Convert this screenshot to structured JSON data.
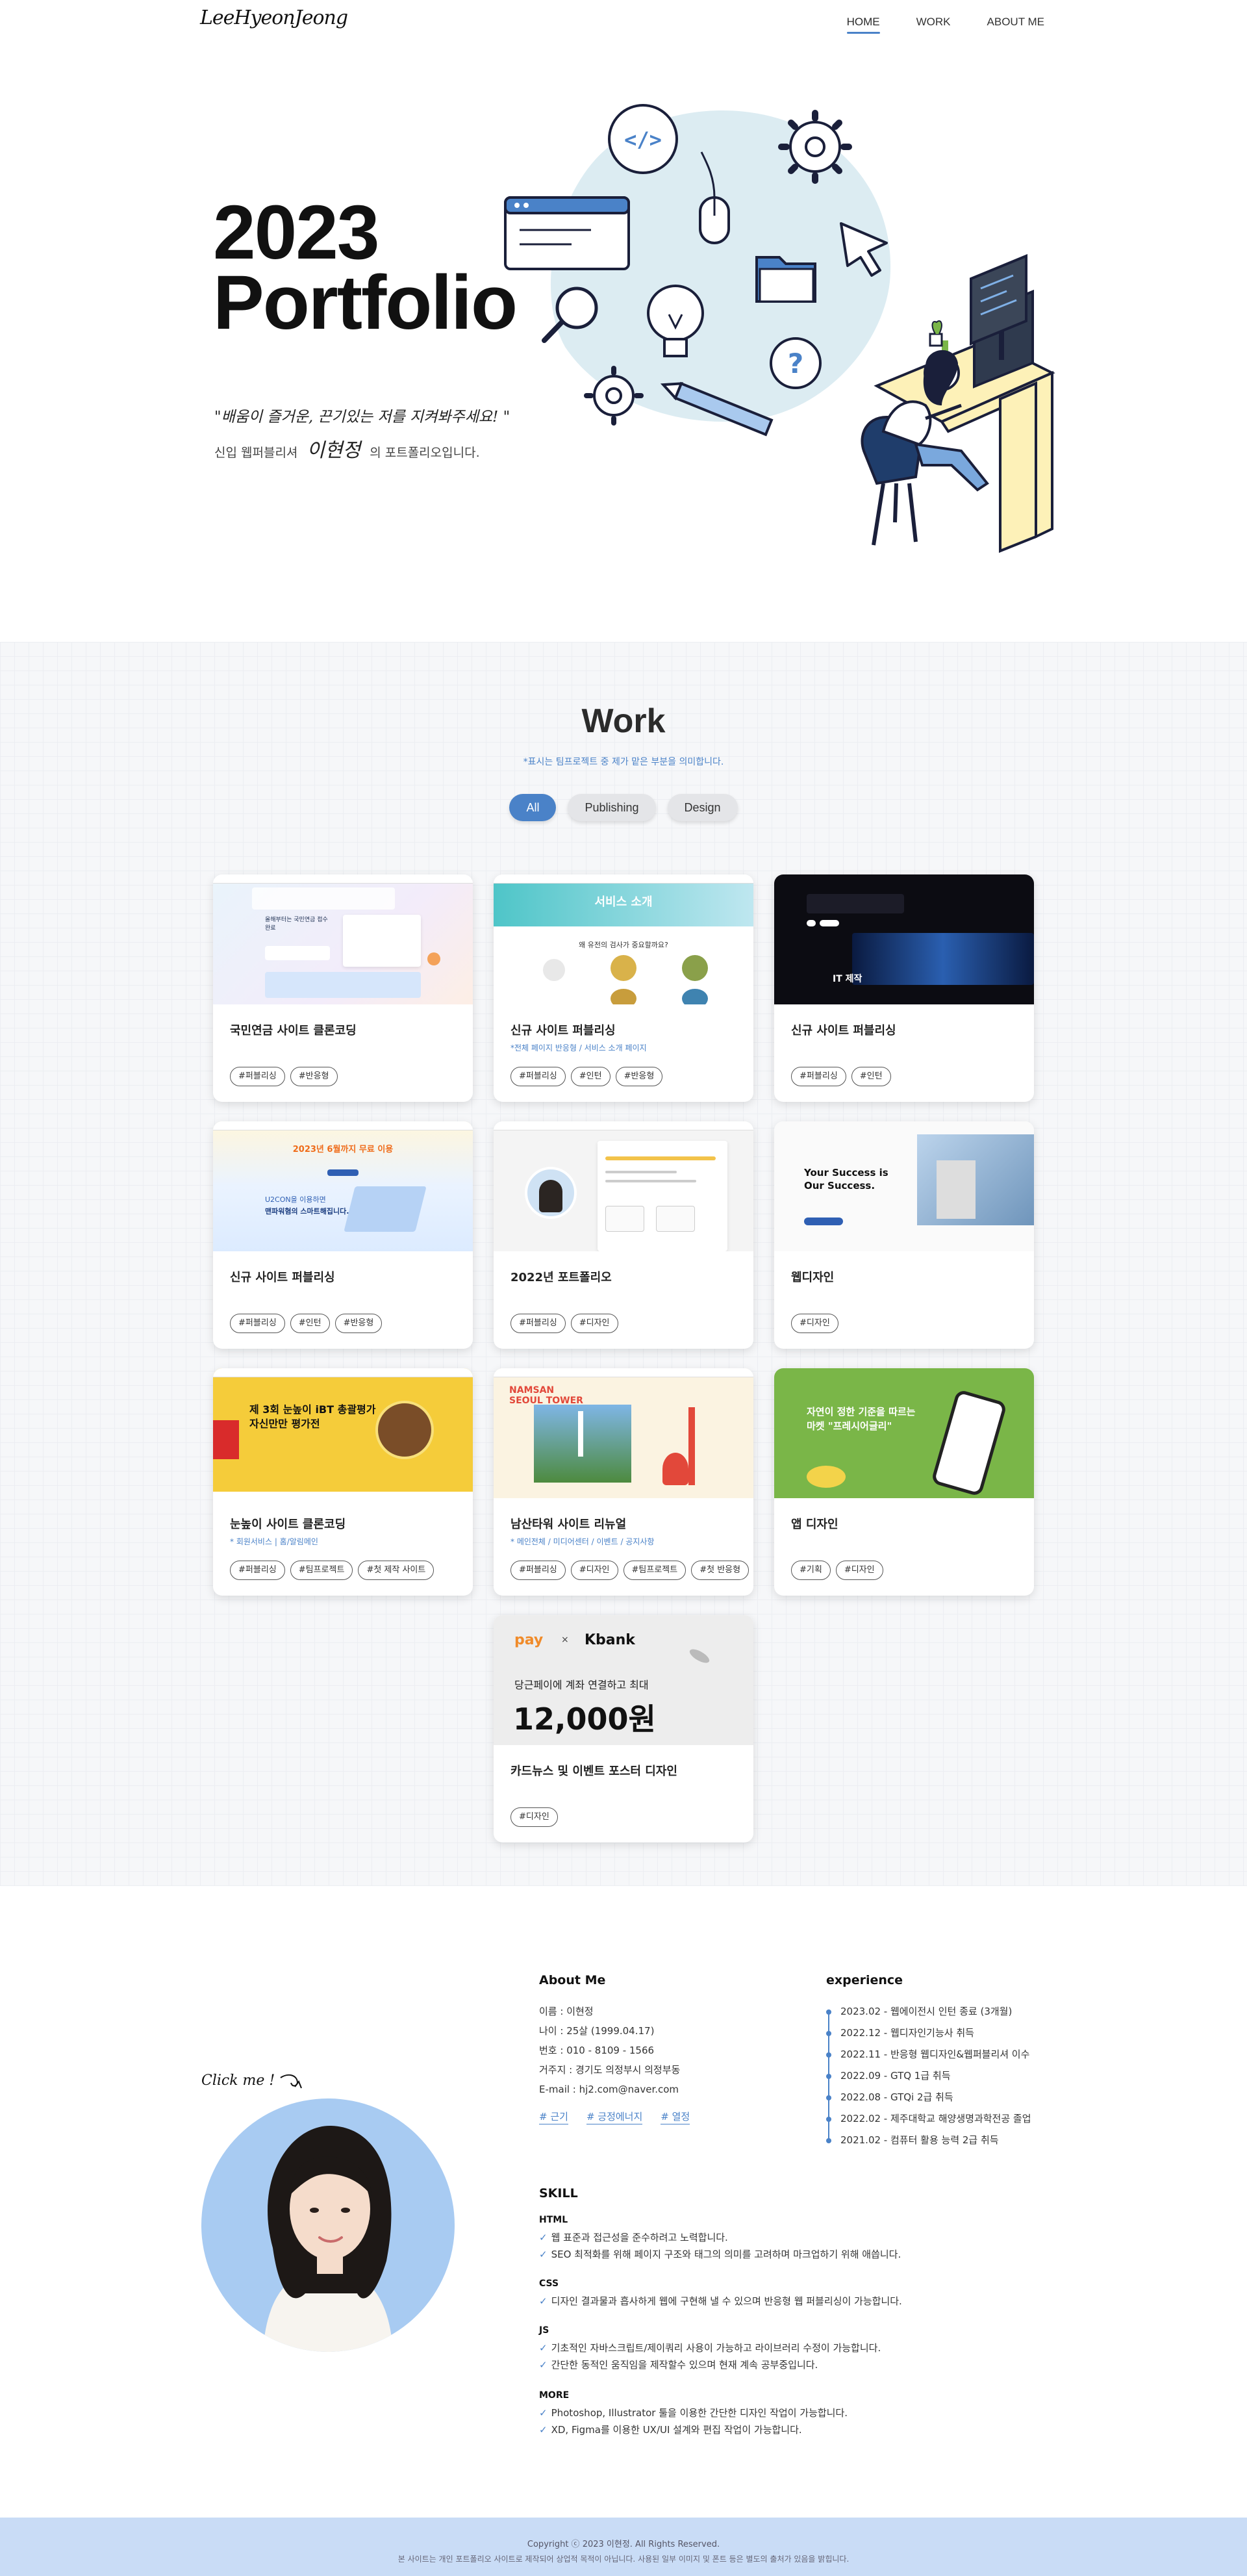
{
  "header": {
    "logo": "LeeHyeonJeong",
    "nav": [
      "HOME",
      "WORK",
      "ABOUT ME"
    ]
  },
  "hero": {
    "title_line1": "2023",
    "title_line2": "Portfolio",
    "quote": "\"배움이 즐거운, 끈기있는 저를 지켜봐주세요! \"",
    "intro_prefix": "신입 웹퍼블리셔",
    "intro_name": "이현정",
    "intro_suffix": "의 포트폴리오입니다."
  },
  "work": {
    "title": "Work",
    "subtitle": "*표시는 팀프로젝트 중 제가 맡은 부분을 의미합니다.",
    "filters": [
      "All",
      "Publishing",
      "Design"
    ],
    "cards": [
      {
        "title": "국민연금 사이트 클론코딩",
        "desc": "",
        "tags": [
          "#퍼블리싱",
          "#반응형"
        ]
      },
      {
        "title": "신규 사이트 퍼블리싱",
        "desc": "*전체 페이지 반응형 / 서비스 소개 페이지",
        "tags": [
          "#퍼블리싱",
          "#인턴",
          "#반응형"
        ]
      },
      {
        "title": "신규 사이트 퍼블리싱",
        "desc": "",
        "tags": [
          "#퍼블리싱",
          "#인턴"
        ]
      },
      {
        "title": "신규 사이트 퍼블리싱",
        "desc": "",
        "tags": [
          "#퍼블리싱",
          "#인턴",
          "#반응형"
        ]
      },
      {
        "title": "2022년 포트폴리오",
        "desc": "",
        "tags": [
          "#퍼블리싱",
          "#디자인"
        ]
      },
      {
        "title": "웹디자인",
        "desc": "",
        "tags": [
          "#디자인"
        ]
      },
      {
        "title": "눈높이 사이트 클론코딩",
        "desc": "* 회원서비스 | 홈/알림메인",
        "tags": [
          "#퍼블리싱",
          "#팀프로젝트",
          "#첫 제작 사이트"
        ]
      },
      {
        "title": "남산타워 사이트 리뉴얼",
        "desc": "* 메인전체 / 미디어센터 / 이벤트 / 공지사항",
        "tags": [
          "#퍼블리싱",
          "#디자인",
          "#팀프로젝트",
          "#첫 반응형"
        ]
      },
      {
        "title": "앱 디자인",
        "desc": "",
        "tags": [
          "#기획",
          "#디자인"
        ]
      },
      {
        "title": "카드뉴스 및 이벤트 포스터 디자인",
        "desc": "",
        "tags": [
          "#디자인"
        ]
      }
    ],
    "thumb_text": {
      "service": "서비스 소개",
      "service_q": "왜 유전의 검사가 중요할까요?",
      "nps_text": "올해부터는 국민연금 접수 완료",
      "dark_text": "IT 제작",
      "blue_head": "2023년 6월까지 무료 이용",
      "blue_brand": "U2CON을 이용하면",
      "blue_sub": "맨파워혐의 스마트해집니다.",
      "web_line1": "Your Success is",
      "web_line2": "Our Success.",
      "yellow_line1": "제 3회 눈높이 iBT 총괄평가",
      "yellow_line2": "자신만만 평가전",
      "namsan_title": "NAMSAN SEOUL TOWER",
      "app_line1": "자연이 정한 기준을 따르는",
      "app_line2": "마켓 \"프레시어글리\"",
      "kbank_brand1": "pay",
      "kbank_brand2": "Kbank",
      "kbank_line": "당근페이에 계좌 연결하고 최대",
      "kbank_amount": "12,000원"
    }
  },
  "about": {
    "click_me": "Click me !",
    "about_title": "About Me",
    "info": [
      "이름 : 이현정",
      "나이 : 25살 (1999.04.17)",
      "번호 : 010 - 8109 - 1566",
      "거주지 : 경기도 의정부시 의정부동",
      "E-mail : hj2.com@naver.com"
    ],
    "links": [
      "# 근기",
      "# 긍정에너지",
      "# 열정"
    ],
    "experience_title": "experience",
    "experience": [
      "2023.02 - 웹에이전시 인턴 종료 (3개월)",
      "2022.12 - 웹디자인기능사 취득",
      "2022.11 - 반응형 웹디자인&웹퍼블리셔 이수",
      "2022.09 - GTQ 1급 취득",
      "2022.08 - GTQi 2급 취득",
      "2022.02 - 제주대학교 해양생명과학전공 졸업",
      "2021.02 - 컴퓨터 활용 능력 2급 취득"
    ],
    "skill_title": "SKILL",
    "skills": [
      {
        "cat": "HTML",
        "items": [
          "웹 표준과 접근성을 준수하려고 노력합니다.",
          "SEO 최적화를 위해 페이지 구조와 태그의 의미를 고려하며 마크업하기 위해 애씁니다."
        ]
      },
      {
        "cat": "CSS",
        "items": [
          "디자인 결과물과 흡사하게 웹에 구현해 낼 수 있으며 반응형 웹 퍼블리싱이 가능합니다."
        ]
      },
      {
        "cat": "JS",
        "items": [
          "기초적인 자바스크립트/제이쿼리 사용이 가능하고 라이브러리 수정이 가능합니다.",
          "간단한 동적인 움직임을 제작할수 있으며 현재 계속 공부중입니다."
        ]
      },
      {
        "cat": "MORE",
        "items": [
          "Photoshop, Illustrator 툴을 이용한 간단한 디자인 작업이 가능합니다.",
          "XD, Figma를 이용한 UX/UI 설계와 편집 작업이 가능합니다."
        ]
      }
    ]
  },
  "footer": {
    "copyright": "Copyright ⓒ 2023 이현정. All Rights Reserved.",
    "note": "본 사이트는 개인 포트폴리오 사이트로 제작되어 상업적 목적이 아닙니다. 사용된 일부 이미지 및 폰트 등은 별도의 출처가 있음을 밝힙니다."
  },
  "colors": {
    "accent": "#4a82c8",
    "footer_bg": "#c9dcf6",
    "illus_blob": "#dcecf2",
    "desk": "#fdf1b8"
  }
}
